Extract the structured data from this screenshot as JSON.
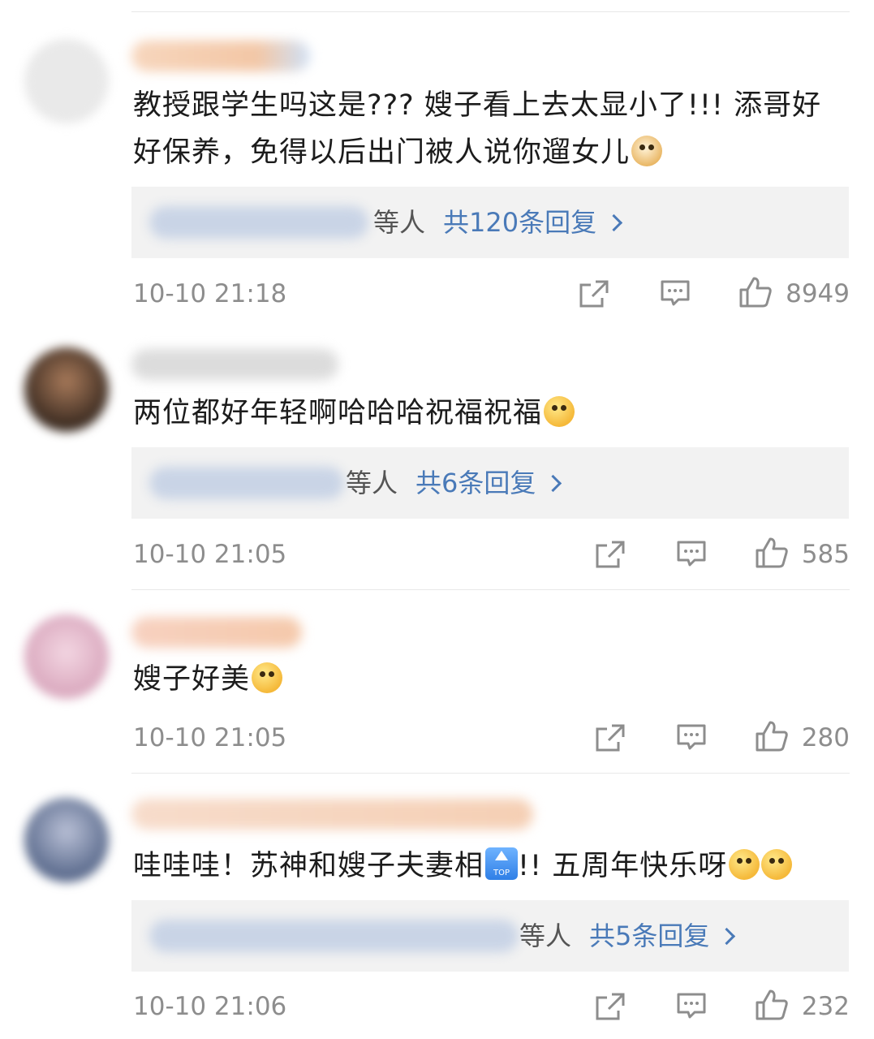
{
  "comments": [
    {
      "text": "教授跟学生吗这是??? 嫂子看上去太显小了!!! 添哥好好保养，免得以后出门被人说你遛女儿",
      "emoji": "doge-emoji",
      "replies_etc": "等人",
      "replies_total": "共120条回复",
      "time": "10-10 21:18",
      "likes": "8949"
    },
    {
      "text": "两位都好年轻啊哈哈哈祝福祝福",
      "emoji": "shocked-face-emoji",
      "replies_etc": "等人",
      "replies_total": "共6条回复",
      "time": "10-10 21:05",
      "likes": "585"
    },
    {
      "text": "嫂子好美",
      "emoji": "heart-face-emoji",
      "time": "10-10 21:05",
      "likes": "280"
    },
    {
      "text": "哇哇哇！苏神和嫂子夫妻相",
      "top_badge": "TOP",
      "text_after": "!! 五周年快乐呀",
      "emoji": "crying-laughing-emoji",
      "replies_etc": "等人",
      "replies_total": "共5条回复",
      "time": "10-10 21:06",
      "likes": "232"
    }
  ],
  "icons": {
    "share": "share-icon",
    "comment": "comment-icon",
    "like": "thumbs-up-icon"
  }
}
